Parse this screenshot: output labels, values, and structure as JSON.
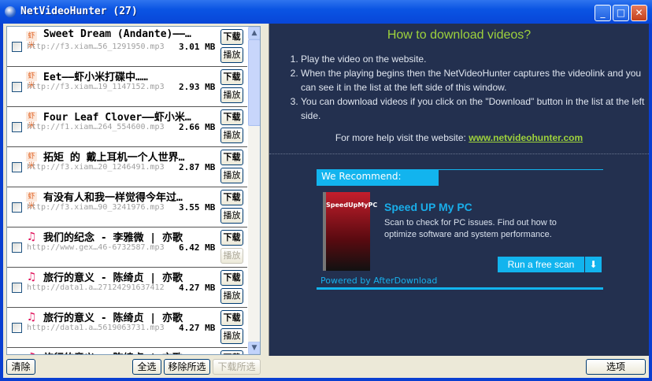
{
  "window": {
    "title": "NetVideoHunter (27)",
    "minimize": "_",
    "maximize": "□",
    "close": "✕"
  },
  "items": [
    {
      "type": "xiami",
      "title": "Sweet Dream (Andante)——…",
      "url": "http://f3.xiam…56_1291950.mp3",
      "size": "3.01 MB",
      "download": "下载",
      "play": "播放",
      "play_enabled": true
    },
    {
      "type": "xiami",
      "title": "Eet——虾小米打碟中……",
      "url": "http://f3.xiam…19_1147152.mp3",
      "size": "2.93 MB",
      "download": "下载",
      "play": "播放",
      "play_enabled": true
    },
    {
      "type": "xiami",
      "title": "Four Leaf Clover——虾小米…",
      "url": "http://f1.xiam…264_554600.mp3",
      "size": "2.66 MB",
      "download": "下载",
      "play": "播放",
      "play_enabled": true
    },
    {
      "type": "xiami",
      "title": "拓矩 的 戴上耳机一个人世界…",
      "url": "http://f3.xiam…20_1246491.mp3",
      "size": "2.87 MB",
      "download": "下载",
      "play": "播放",
      "play_enabled": true
    },
    {
      "type": "xiami",
      "title": "有没有人和我一样觉得今年过…",
      "url": "http://f3.xiam…90_3241976.mp3",
      "size": "3.55 MB",
      "download": "下载",
      "play": "播放",
      "play_enabled": true
    },
    {
      "type": "music",
      "title": "我们的纪念 - 李雅微 | 亦歌",
      "url": "http://www.gex…46-6732587.mp3",
      "size": "6.42 MB",
      "download": "下载",
      "play": "播放",
      "play_enabled": false
    },
    {
      "type": "music",
      "title": "旅行的意义 - 陈绮贞 | 亦歌",
      "url": "http://data1.a…27124291637412",
      "size": "4.27 MB",
      "download": "下载",
      "play": "播放",
      "play_enabled": true
    },
    {
      "type": "music",
      "title": "旅行的意义 - 陈绮贞 | 亦歌",
      "url": "http://data1.a…5619063731.mp3",
      "size": "4.27 MB",
      "download": "下载",
      "play": "播放",
      "play_enabled": true
    },
    {
      "type": "music",
      "title": "旅行的意义 - 陈绮贞 | 亦歌",
      "url": "",
      "size": "",
      "download": "下载",
      "play": "",
      "play_enabled": true
    }
  ],
  "icons": {
    "xiami": "虾米",
    "music": "♫"
  },
  "bottom": {
    "clear": "清除",
    "select_all": "全选",
    "remove_selected": "移除所选",
    "download_selected": "下载所选",
    "options": "选项"
  },
  "help": {
    "title": "How to download videos?",
    "steps": [
      "Play the video on the website.",
      "When the playing begins then the NetVideoHunter captures the videolink and you can see it in the list at the left side of this window.",
      "You can download videos if you click on the \"Download\" button in the list at the left side."
    ],
    "more": "For more help visit the website: ",
    "link": "www.netvideohunter.com"
  },
  "ad": {
    "header": "We Recommend:",
    "product_box": "SpeedUpMyPC",
    "title": "Speed UP My PC",
    "desc": "Scan to check for PC issues. Find out how to optimize software and system performance.",
    "button": "Run a free scan",
    "powered": "Powered by AfterDownload"
  },
  "colors": {
    "accent": "#12b4ee",
    "link": "#9ed23c",
    "panel": "#23304f"
  }
}
